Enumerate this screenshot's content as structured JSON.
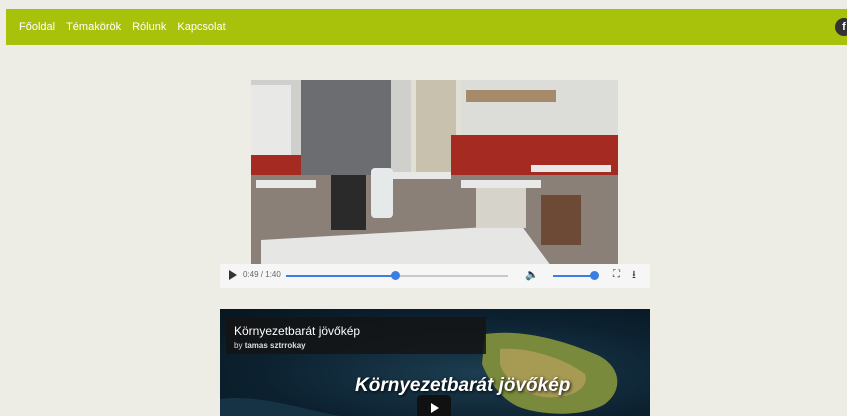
{
  "nav": {
    "items": [
      {
        "label": "Főoldal"
      },
      {
        "label": "Témakörök"
      },
      {
        "label": "Rólunk"
      },
      {
        "label": "Kapcsolat"
      }
    ]
  },
  "social": {
    "icon": "facebook-icon",
    "glyph": "f"
  },
  "video_player": {
    "time_display": "0:49 / 1:40",
    "progress_fraction": 0.49,
    "volume_fraction": 0.9,
    "icons": [
      "play-icon",
      "volume-icon",
      "fullscreen-icon",
      "download-icon"
    ]
  },
  "embed": {
    "title": "Környezetbarát jövőkép",
    "by_prefix": "by",
    "author": "tamas sztrrokay",
    "overlay_title": "Környezetbarát jövőkép"
  },
  "colors": {
    "nav_bg": "#a8c20c",
    "page_bg": "#edece5",
    "accent": "#3b7ee3"
  }
}
